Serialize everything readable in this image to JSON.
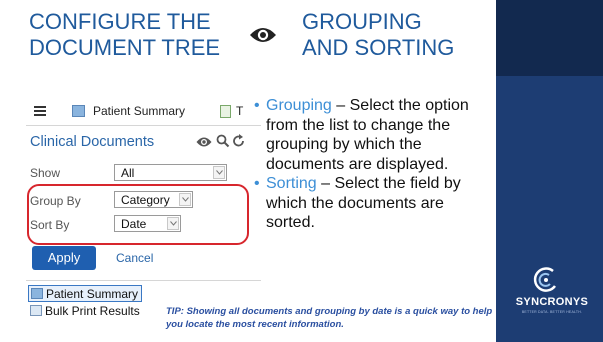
{
  "slide": {
    "title_left_line1": "CONFIGURE THE",
    "title_left_line2": "DOCUMENT TREE",
    "title_right_line1": "GROUPING",
    "title_right_line2": "AND SORTING",
    "title_icon": "eye-icon"
  },
  "app": {
    "tab_active_label": "Patient Summary",
    "tab_next_label": "T",
    "panel_title": "Clinical Documents",
    "toolbar_icons": [
      "eye-icon",
      "search-icon",
      "refresh-icon"
    ],
    "show_label": "Show",
    "show_value": "All",
    "group_label": "Group By",
    "group_value": "Category",
    "sort_label": "Sort By",
    "sort_value": "Date",
    "apply_label": "Apply",
    "cancel_label": "Cancel",
    "tree_items": [
      "Patient Summary",
      "Bulk Print Results"
    ]
  },
  "bullets": [
    {
      "keyword": "Grouping",
      "text": " – Select the option from the list to change the grouping by which the documents are displayed."
    },
    {
      "keyword": "Sorting",
      "text": " – Select the field by which the documents are sorted."
    }
  ],
  "tip": "TIP:  Showing all documents and grouping by date is a quick way to help you locate the most recent information.",
  "brand": {
    "name": "SYNCRONYS",
    "tagline": "BETTER DATA. BETTER HEALTH.",
    "band_color": "#1d3d73",
    "accent_color": "#3d8fd6",
    "title_color": "#1f5a9c",
    "highlight_color": "#d7262d"
  }
}
